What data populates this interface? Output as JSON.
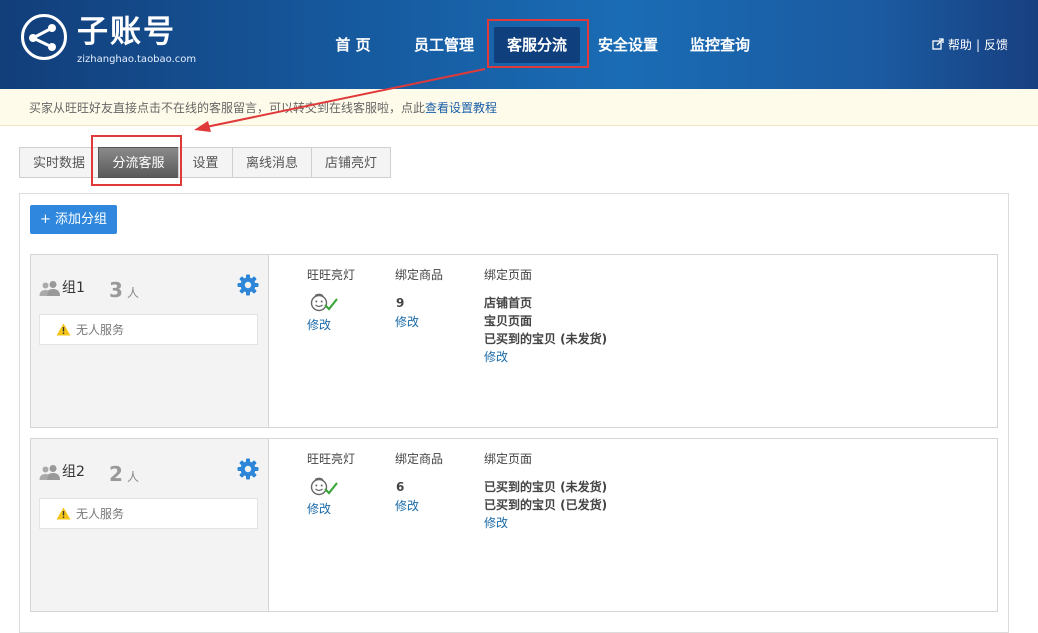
{
  "logo": {
    "title": "子账号",
    "subtitle": "zizhanghao.taobao.com"
  },
  "nav": {
    "items": [
      {
        "label": "首 页"
      },
      {
        "label": "员工管理"
      },
      {
        "label": "客服分流"
      },
      {
        "label": "安全设置"
      },
      {
        "label": "监控查询"
      }
    ],
    "active_index": 2,
    "help": "帮助",
    "feedback": "反馈"
  },
  "notice": {
    "text": "买家从旺旺好友直接点击不在线的客服留言，可以转交到在线客服啦，点此",
    "link": "查看设置教程"
  },
  "tabs": [
    {
      "label": "实时数据"
    },
    {
      "label": "分流客服"
    },
    {
      "label": "设置"
    },
    {
      "label": "离线消息"
    },
    {
      "label": "店铺亮灯"
    }
  ],
  "active_tab": 1,
  "add_button": "+ 添加分组",
  "columns": {
    "light": "旺旺亮灯",
    "goods": "绑定商品",
    "pages": "绑定页面"
  },
  "edit_label": "修改",
  "groups": [
    {
      "name": "组1",
      "count": "3",
      "unit": "人",
      "status": "无人服务",
      "goods_count": "9",
      "pages": [
        "店铺首页",
        "宝贝页面",
        "已买到的宝贝 (未发货)"
      ]
    },
    {
      "name": "组2",
      "count": "2",
      "unit": "人",
      "status": "无人服务",
      "goods_count": "6",
      "pages": [
        "已买到的宝贝 (未发货)",
        "已买到的宝贝 (已发货)"
      ]
    }
  ],
  "colors": {
    "header": "#165a9f",
    "accent": "#2f88de",
    "highlight": "#e0393a",
    "link": "#1a6aa8"
  }
}
